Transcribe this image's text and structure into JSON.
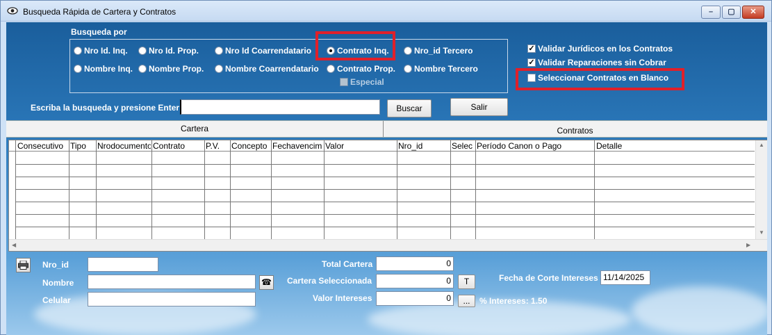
{
  "window": {
    "title": "Busqueda Rápida de Cartera y Contratos",
    "min_symbol": "–",
    "max_symbol": "▢",
    "close_symbol": "✕"
  },
  "search": {
    "group_label": "Busqueda por",
    "options_row1": [
      "Nro Id. Inq.",
      "Nro Id. Prop.",
      "Nro Id Coarrendatario",
      "Contrato Inq.",
      "Nro_id Tercero"
    ],
    "options_row2": [
      "Nombre Inq.",
      "Nombre Prop.",
      "Nombre Coarrendatario",
      "Contrato Prop.",
      "Nombre Tercero"
    ],
    "selected": "Contrato Inq.",
    "especial_label": "Especial",
    "prompt": "Escriba la busqueda y presione Enter",
    "query_value": "",
    "buscar_label": "Buscar",
    "salir_label": "Salir"
  },
  "options": {
    "validar_juridicos": "Validar Jurídicos en los Contratos",
    "validar_reparaciones": "Validar Reparaciones sin Cobrar",
    "seleccionar_blanco": "Seleccionar Contratos en Blanco",
    "validar_juridicos_checked": true,
    "validar_reparaciones_checked": true,
    "seleccionar_blanco_checked": false
  },
  "tabs": [
    "Cartera",
    "Contratos"
  ],
  "table": {
    "columns": [
      "Consecutivo",
      "Tipo",
      "Nrodocumento",
      "Contrato",
      "P.V.",
      "Concepto",
      "Fechavencim",
      "Valor",
      "Nro_id",
      "Selec",
      "Período Canon o Pago",
      "Detalle"
    ]
  },
  "footer": {
    "nro_id_label": "Nro_id",
    "nombre_label": "Nombre",
    "celular_label": "Celular",
    "nro_id_value": "",
    "nombre_value": "",
    "celular_value": "",
    "total_cartera_label": "Total Cartera",
    "total_cartera_value": "0",
    "cartera_sel_label": "Cartera Seleccionada",
    "cartera_sel_value": "0",
    "valor_intereses_label": "Valor Intereses",
    "valor_intereses_value": "0",
    "t_button": "T",
    "dots_button": "...",
    "pct_intereses": "% Intereses: 1.50",
    "fecha_corte_label": "Fecha de Corte Intereses",
    "fecha_corte_value": "11/14/2025"
  }
}
